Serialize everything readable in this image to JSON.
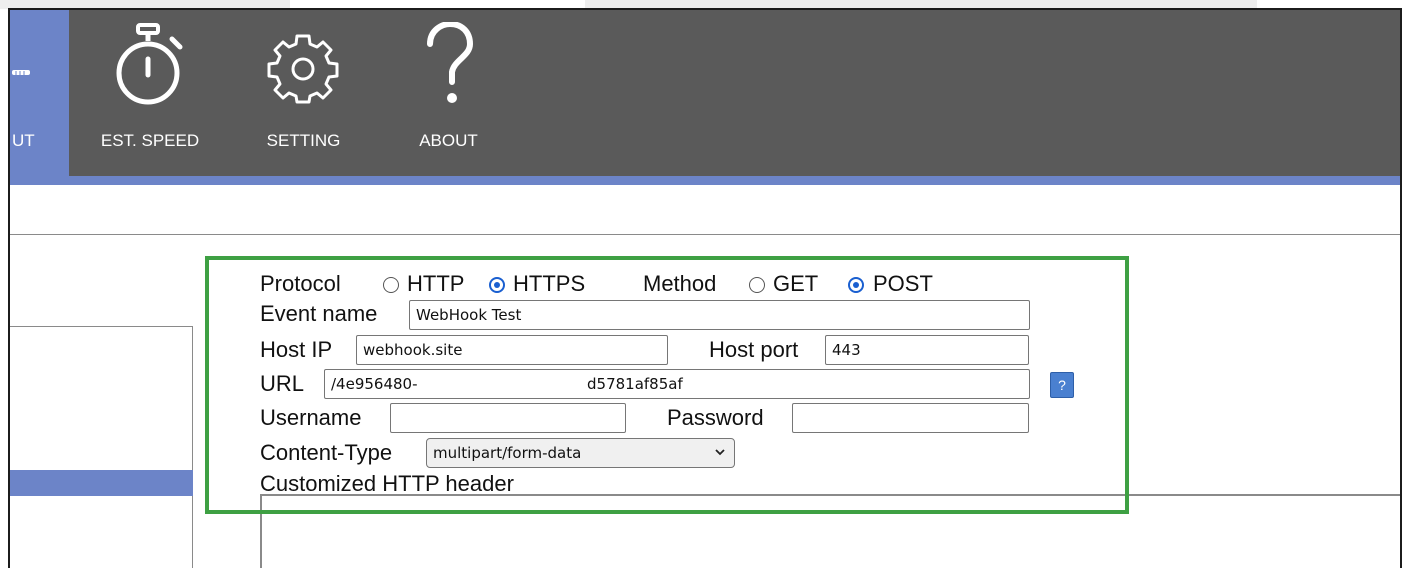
{
  "nav": {
    "items": [
      {
        "label": "UT",
        "icon": "speedometer-icon",
        "active": true
      },
      {
        "label": "EST. SPEED",
        "icon": "stopwatch-icon",
        "active": false
      },
      {
        "label": "SETTING",
        "icon": "gear-icon",
        "active": false
      },
      {
        "label": "ABOUT",
        "icon": "question-icon",
        "active": false
      }
    ]
  },
  "form": {
    "protocol_label": "Protocol",
    "protocol_options": [
      "HTTP",
      "HTTPS"
    ],
    "protocol_selected": "HTTPS",
    "method_label": "Method",
    "method_options": [
      "GET",
      "POST"
    ],
    "method_selected": "POST",
    "event_name_label": "Event name",
    "event_name_value": "WebHook Test",
    "host_ip_label": "Host IP",
    "host_ip_value": "webhook.site",
    "host_port_label": "Host port",
    "host_port_value": "443",
    "url_label": "URL",
    "url_value_start": "/4e956480-",
    "url_value_end": "d5781af85af",
    "url_help_label": "?",
    "username_label": "Username",
    "username_value": "",
    "password_label": "Password",
    "password_value": "",
    "content_type_label": "Content-Type",
    "content_type_value": "multipart/form-data",
    "custom_header_label": "Customized HTTP header"
  },
  "colors": {
    "toolbar": "#5a5a5a",
    "accent": "#6c84c8",
    "highlight_border": "#3ea043",
    "radio_selected": "#1a5fd0"
  }
}
